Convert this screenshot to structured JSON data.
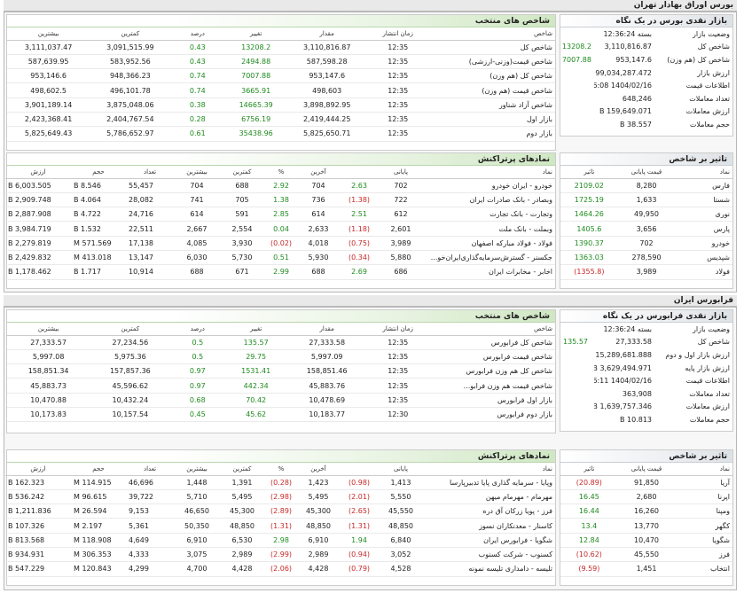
{
  "window_title": "بورس اوراق بهادار تهران",
  "tse": {
    "snapshot": {
      "title": "بازار نقدی بورس در یک نگاه",
      "rows": [
        {
          "label": "وضعیت بازار",
          "value": "بسته 12:36:24",
          "change": ""
        },
        {
          "label": "شاخص کل",
          "value": "3,110,816.87",
          "change": "13208.2"
        },
        {
          "label": "شاخص کل (هم وزن)",
          "value": "953,147.6",
          "change": "7007.88"
        },
        {
          "label": "ارزش بازار",
          "value": "99,034,287.472 B",
          "change": ""
        },
        {
          "label": "اطلاعات قیمت",
          "value": "1404/02/16 12:36:08",
          "change": ""
        },
        {
          "label": "تعداد معاملات",
          "value": "648,246",
          "change": ""
        },
        {
          "label": "ارزش معاملات",
          "value": "159,649.071 B",
          "change": ""
        },
        {
          "label": "حجم معاملات",
          "value": "38.557 B",
          "change": ""
        }
      ]
    },
    "indices": {
      "title": "شاخص های منتخب",
      "headers": [
        "شاخص",
        "زمان انتشار",
        "مقدار",
        "تغییر",
        "درصد",
        "کمترین",
        "بیشترین"
      ],
      "rows": [
        [
          "شاخص کل",
          "12:35",
          "3,110,816.87",
          "13208.2",
          "0.43",
          "3,091,515.99",
          "3,111,037.47"
        ],
        [
          "شاخص قیمت(وزنی-ارزشی)",
          "12:35",
          "587,598.28",
          "2494.88",
          "0.43",
          "583,952.56",
          "587,639.95"
        ],
        [
          "شاخص کل (هم وزن)",
          "12:35",
          "953,147.6",
          "7007.88",
          "0.74",
          "948,366.23",
          "953,146.6"
        ],
        [
          "شاخص قیمت (هم وزن)",
          "12:35",
          "498,603",
          "3665.91",
          "0.74",
          "496,101.78",
          "498,602.5"
        ],
        [
          "شاخص آزاد شناور",
          "12:35",
          "3,898,892.95",
          "14665.39",
          "0.38",
          "3,875,048.06",
          "3,901,189.14"
        ],
        [
          "بازار اول",
          "12:35",
          "2,419,444.25",
          "6756.19",
          "0.28",
          "2,404,767.54",
          "2,423,368.41"
        ],
        [
          "بازار دوم",
          "12:35",
          "5,825,650.71",
          "35438.96",
          "0.61",
          "5,786,652.97",
          "5,825,649.43"
        ]
      ]
    },
    "impact": {
      "title": "تاثیر بر شاخص",
      "headers": [
        "نماد",
        "قیمت پایانی",
        "تاثیر"
      ],
      "rows": [
        [
          "فارس",
          "8,280",
          "2109.02"
        ],
        [
          "شستا",
          "1,633",
          "1725.19"
        ],
        [
          "نوری",
          "49,950",
          "1464.26"
        ],
        [
          "پارس",
          "3,656",
          "1405.6"
        ],
        [
          "خودرو",
          "702",
          "1390.37"
        ],
        [
          "شپدیس",
          "278,590",
          "1363.03"
        ],
        [
          "فولاد",
          "3,989",
          "(1355.8)"
        ]
      ]
    },
    "top_symbols": {
      "title": "نمادهای پرتراکنش",
      "headers": [
        "نماد",
        "پایانی",
        "",
        "آخرین",
        "%",
        "کمترین",
        "بیشترین",
        "تعداد",
        "حجم",
        "ارزش"
      ],
      "rows": [
        [
          "خودرو - ایران خودرو",
          "702",
          "2.63",
          "704",
          "2.92",
          "688",
          "704",
          "55,457",
          "8.546 B",
          "6,003.505 B"
        ],
        [
          "وبصادر - بانک صادرات ایران",
          "722",
          "(1.38)",
          "736",
          "1.38",
          "705",
          "741",
          "28,082",
          "4.064 B",
          "2,909.748 B"
        ],
        [
          "وتجارت - بانک تجارت",
          "612",
          "2.51",
          "614",
          "2.85",
          "591",
          "614",
          "24,716",
          "4.722 B",
          "2,887.908 B"
        ],
        [
          "وبملت - بانک ملت",
          "2,601",
          "(1.18)",
          "2,633",
          "0.04",
          "2,554",
          "2,667",
          "22,511",
          "1.532 B",
          "3,984.719 B"
        ],
        [
          "فولاد - فولاد مبارکه اصفهان",
          "3,989",
          "(0.75)",
          "4,018",
          "(0.02)",
          "3,930",
          "4,085",
          "17,138",
          "571.569 M",
          "2,279.819 B"
        ],
        [
          "جکسنر - گسترش‌سرمایه‌گذاری‌ایران‌خو...",
          "5,880",
          "(0.34)",
          "5,930",
          "0.51",
          "5,730",
          "6,030",
          "13,147",
          "413.018 M",
          "2,429.832 B"
        ],
        [
          "اخابر - مخابرات ایران",
          "686",
          "2.69",
          "688",
          "2.99",
          "671",
          "688",
          "10,914",
          "1.717 B",
          "1,178.462 B"
        ]
      ]
    }
  },
  "ifb": {
    "bar_title": "فرابورس ایران",
    "snapshot": {
      "title": "بازار نقدی فرابورس در یک نگاه",
      "rows": [
        {
          "label": "وضعیت بازار",
          "value": "بسته 12:36:24",
          "change": ""
        },
        {
          "label": "شاخص کل",
          "value": "27,333.58",
          "change": "135.57"
        },
        {
          "label": "ارزش بازار اول و دوم",
          "value": "15,289,681.888 B",
          "change": ""
        },
        {
          "label": "ارزش بازار پایه",
          "value": "3,629,494.971 B",
          "change": ""
        },
        {
          "label": "اطلاعات قیمت",
          "value": "1404/02/16 12:36:11",
          "change": ""
        },
        {
          "label": "تعداد معاملات",
          "value": "363,908",
          "change": ""
        },
        {
          "label": "ارزش معاملات",
          "value": "1,639,757.346 B",
          "change": ""
        },
        {
          "label": "حجم معاملات",
          "value": "10.813 B",
          "change": ""
        }
      ]
    },
    "indices": {
      "title": "شاخص های منتخب",
      "headers": [
        "شاخص",
        "زمان انتشار",
        "مقدار",
        "تغییر",
        "درصد",
        "کمترین",
        "بیشترین"
      ],
      "rows": [
        [
          "شاخص کل فرابورس",
          "12:35",
          "27,333.58",
          "135.57",
          "0.5",
          "27,234.56",
          "27,333.57"
        ],
        [
          "شاخص قیمت فرابورس",
          "12:35",
          "5,997.09",
          "29.75",
          "0.5",
          "5,975.36",
          "5,997.08"
        ],
        [
          "شاخص کل هم وزن فرابورس",
          "12:35",
          "158,851.46",
          "1531.41",
          "0.97",
          "157,857.36",
          "158,851.34"
        ],
        [
          "شاخص قیمت هم وزن فرابو...",
          "12:35",
          "45,883.76",
          "442.34",
          "0.97",
          "45,596.62",
          "45,883.73"
        ],
        [
          "بازار اول فرابورس",
          "12:35",
          "10,478.69",
          "70.42",
          "0.68",
          "10,432.24",
          "10,470.88"
        ],
        [
          "بازار دوم فرابورس",
          "12:30",
          "10,183.77",
          "45.62",
          "0.45",
          "10,157.54",
          "10,173.83"
        ]
      ]
    },
    "impact": {
      "title": "تاثیر بر شاخص",
      "headers": [
        "نماد",
        "قیمت پایانی",
        "تاثیر"
      ],
      "rows": [
        [
          "آریا",
          "91,850",
          "(20.89)"
        ],
        [
          "اپرنا",
          "2,680",
          "16.45"
        ],
        [
          "ومپنا",
          "16,260",
          "16.44"
        ],
        [
          "کگهر",
          "13,770",
          "13.4"
        ],
        [
          "شگویا",
          "10,470",
          "12.84"
        ],
        [
          "فرز",
          "45,550",
          "(10.62)"
        ],
        [
          "انتخاب",
          "1,451",
          "(9.59)"
        ]
      ]
    },
    "top_symbols": {
      "title": "نمادهای پرتراکنش",
      "headers": [
        "نماد",
        "پایانی",
        "",
        "آخرین",
        "%",
        "کمترین",
        "بیشترین",
        "تعداد",
        "حجم",
        "ارزش"
      ],
      "rows": [
        [
          "وپایا - سرمایه گذاری پایا تدبیرپارسا",
          "1,413",
          "(0.98)",
          "1,423",
          "(0.28)",
          "1,391",
          "1,448",
          "46,696",
          "114.915 M",
          "162.323 B"
        ],
        [
          "مهرمام - مهرمام میهن",
          "5,550",
          "(2.01)",
          "5,495",
          "(2.98)",
          "5,495",
          "5,710",
          "39,722",
          "96.615 M",
          "536.242 B"
        ],
        [
          "فرز - پویا زرکان آق دره",
          "45,550",
          "(2.65)",
          "45,300",
          "(2.89)",
          "45,300",
          "46,650",
          "9,153",
          "26.594 M",
          "1,211.836 B"
        ],
        [
          "کاسنار - معدنکاران نسوز",
          "48,850",
          "(1.31)",
          "48,850",
          "(1.31)",
          "48,850",
          "50,350",
          "5,361",
          "2.197 M",
          "107.326 B"
        ],
        [
          "شگویا - فرابورس ایران",
          "6,840",
          "1.94",
          "6,910",
          "2.98",
          "6,530",
          "6,910",
          "4,649",
          "118.908 M",
          "813.568 B"
        ],
        [
          "کسنوب - شرکت کسنوب",
          "3,052",
          "(0.94)",
          "2,989",
          "(2.99)",
          "2,989",
          "3,075",
          "4,333",
          "306.353 M",
          "934.931 B"
        ],
        [
          "تلیسه - دامداری تلیسه نمونه",
          "4,528",
          "(0.79)",
          "4,428",
          "(2.06)",
          "4,428",
          "4,700",
          "4,299",
          "120.843 M",
          "547.229 B"
        ]
      ]
    }
  }
}
